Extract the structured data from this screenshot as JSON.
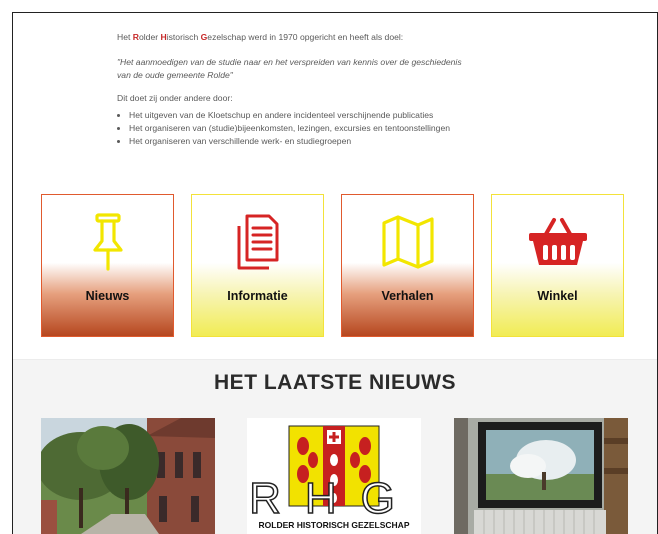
{
  "intro": {
    "lead_parts": [
      "Het ",
      "R",
      "older ",
      "H",
      "istorisch ",
      "G",
      "ezelschap werd in 1970 opgericht en heeft als doel:"
    ],
    "quote_line1": "\"Het aanmoedigen van de studie naar en het verspreiden van kennis over de geschiedenis",
    "quote_line2": "van de oude gemeente Rolde\"",
    "subhead": "Dit doet zij onder andere door:",
    "bullets": [
      "Het uitgeven van de Kloetschup en andere incidenteel verschijnende publicaties",
      "Het organiseren van (studie)bijeenkomsten, lezingen, excursies en tentoonstellingen",
      "Het organiseren van verschillende werk- en studiegroepen"
    ]
  },
  "cards": [
    {
      "label": "Nieuws",
      "icon": "pushpin-icon",
      "style": "red"
    },
    {
      "label": "Informatie",
      "icon": "documents-icon",
      "style": "yellow"
    },
    {
      "label": "Verhalen",
      "icon": "map-icon",
      "style": "red"
    },
    {
      "label": "Winkel",
      "icon": "basket-icon",
      "style": "yellow"
    }
  ],
  "colors": {
    "accent_red": "#c62828",
    "card_red": "#b6471f",
    "card_yellow": "#f1ec54",
    "icon_yellow": "#f2e600",
    "icon_red": "#d62424"
  },
  "news": {
    "title": "HET LAATSTE NIEUWS",
    "thumbnails": [
      {
        "name": "church-photo"
      },
      {
        "name": "rhg-logo",
        "logo_letters": "RHG",
        "logo_caption": "ROLDER HISTORISCH GEZELSCHAP"
      },
      {
        "name": "framed-painting-photo"
      }
    ]
  }
}
